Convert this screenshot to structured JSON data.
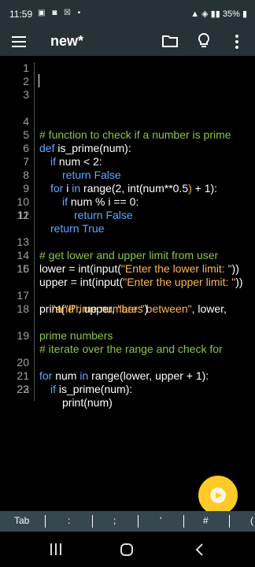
{
  "status_bar": {
    "time": "11:59",
    "battery": "35%"
  },
  "app_bar": {
    "title": "new*"
  },
  "editor": {
    "line_numbers": [
      "1",
      "2",
      "3",
      "4",
      "5",
      "6",
      "7",
      "8",
      "9",
      "10",
      "11",
      "12",
      "13",
      "14",
      "15",
      "16",
      "17",
      "",
      "18",
      "19",
      "",
      "20",
      "21",
      "22",
      "23"
    ],
    "lines": {
      "l4": "# function to check if a number is prime",
      "l5_kw": "def",
      "l5_rest": " is_prime(num):",
      "l6_kw": "if",
      "l6_rest": " num < 2:",
      "l7_kw": "return",
      "l7_kw2": " False",
      "l8_kw": "for",
      "l8_mid": " i ",
      "l8_kw2": "in",
      "l8_rest_a": " range(2, int(num**0.5",
      "l8_paren": ")",
      "l8_rest_b": " + 1):",
      "l9_kw": "if",
      "l9_rest": " num % i == 0:",
      "l10_kw": "return",
      "l10_kw2": " False",
      "l11_kw": "return",
      "l11_kw2": " True",
      "l13": "# get lower and upper limit from user",
      "l14_a": "lower = int(input(",
      "l14_str": "\"Enter the lower limit: \"",
      "l14_b": "))",
      "l15_a": "upper = int(input(",
      "l15_str": "\"Enter the upper limit: \"",
      "l15_b": "))",
      "l17_a": "print(",
      "l17_str": "\"Prime numbers between\"",
      "l17_b": ", lower,",
      "l17c_str": "\"and\"",
      "l17c_b": ", upper, ",
      "l17c_str2": "\"are:\"",
      "l17c_c": ")",
      "l19": "# iterate over the range and check for",
      "l19c": "prime numbers",
      "l20_kw": "for",
      "l20_mid": " num ",
      "l20_kw2": "in",
      "l20_rest": " range(lower, upper + 1):",
      "l21_kw": "if",
      "l21_rest": " is_prime(num):",
      "l22": "print(num)"
    }
  },
  "symbol_bar": {
    "keys": [
      "Tab",
      ":",
      ";",
      "'",
      "#",
      "("
    ]
  },
  "colors": {
    "bar_bg": "#263238",
    "keyword": "#5fa8ff",
    "string": "#ffb74d",
    "comment": "#8bc34a",
    "fab": "#ffca28"
  }
}
